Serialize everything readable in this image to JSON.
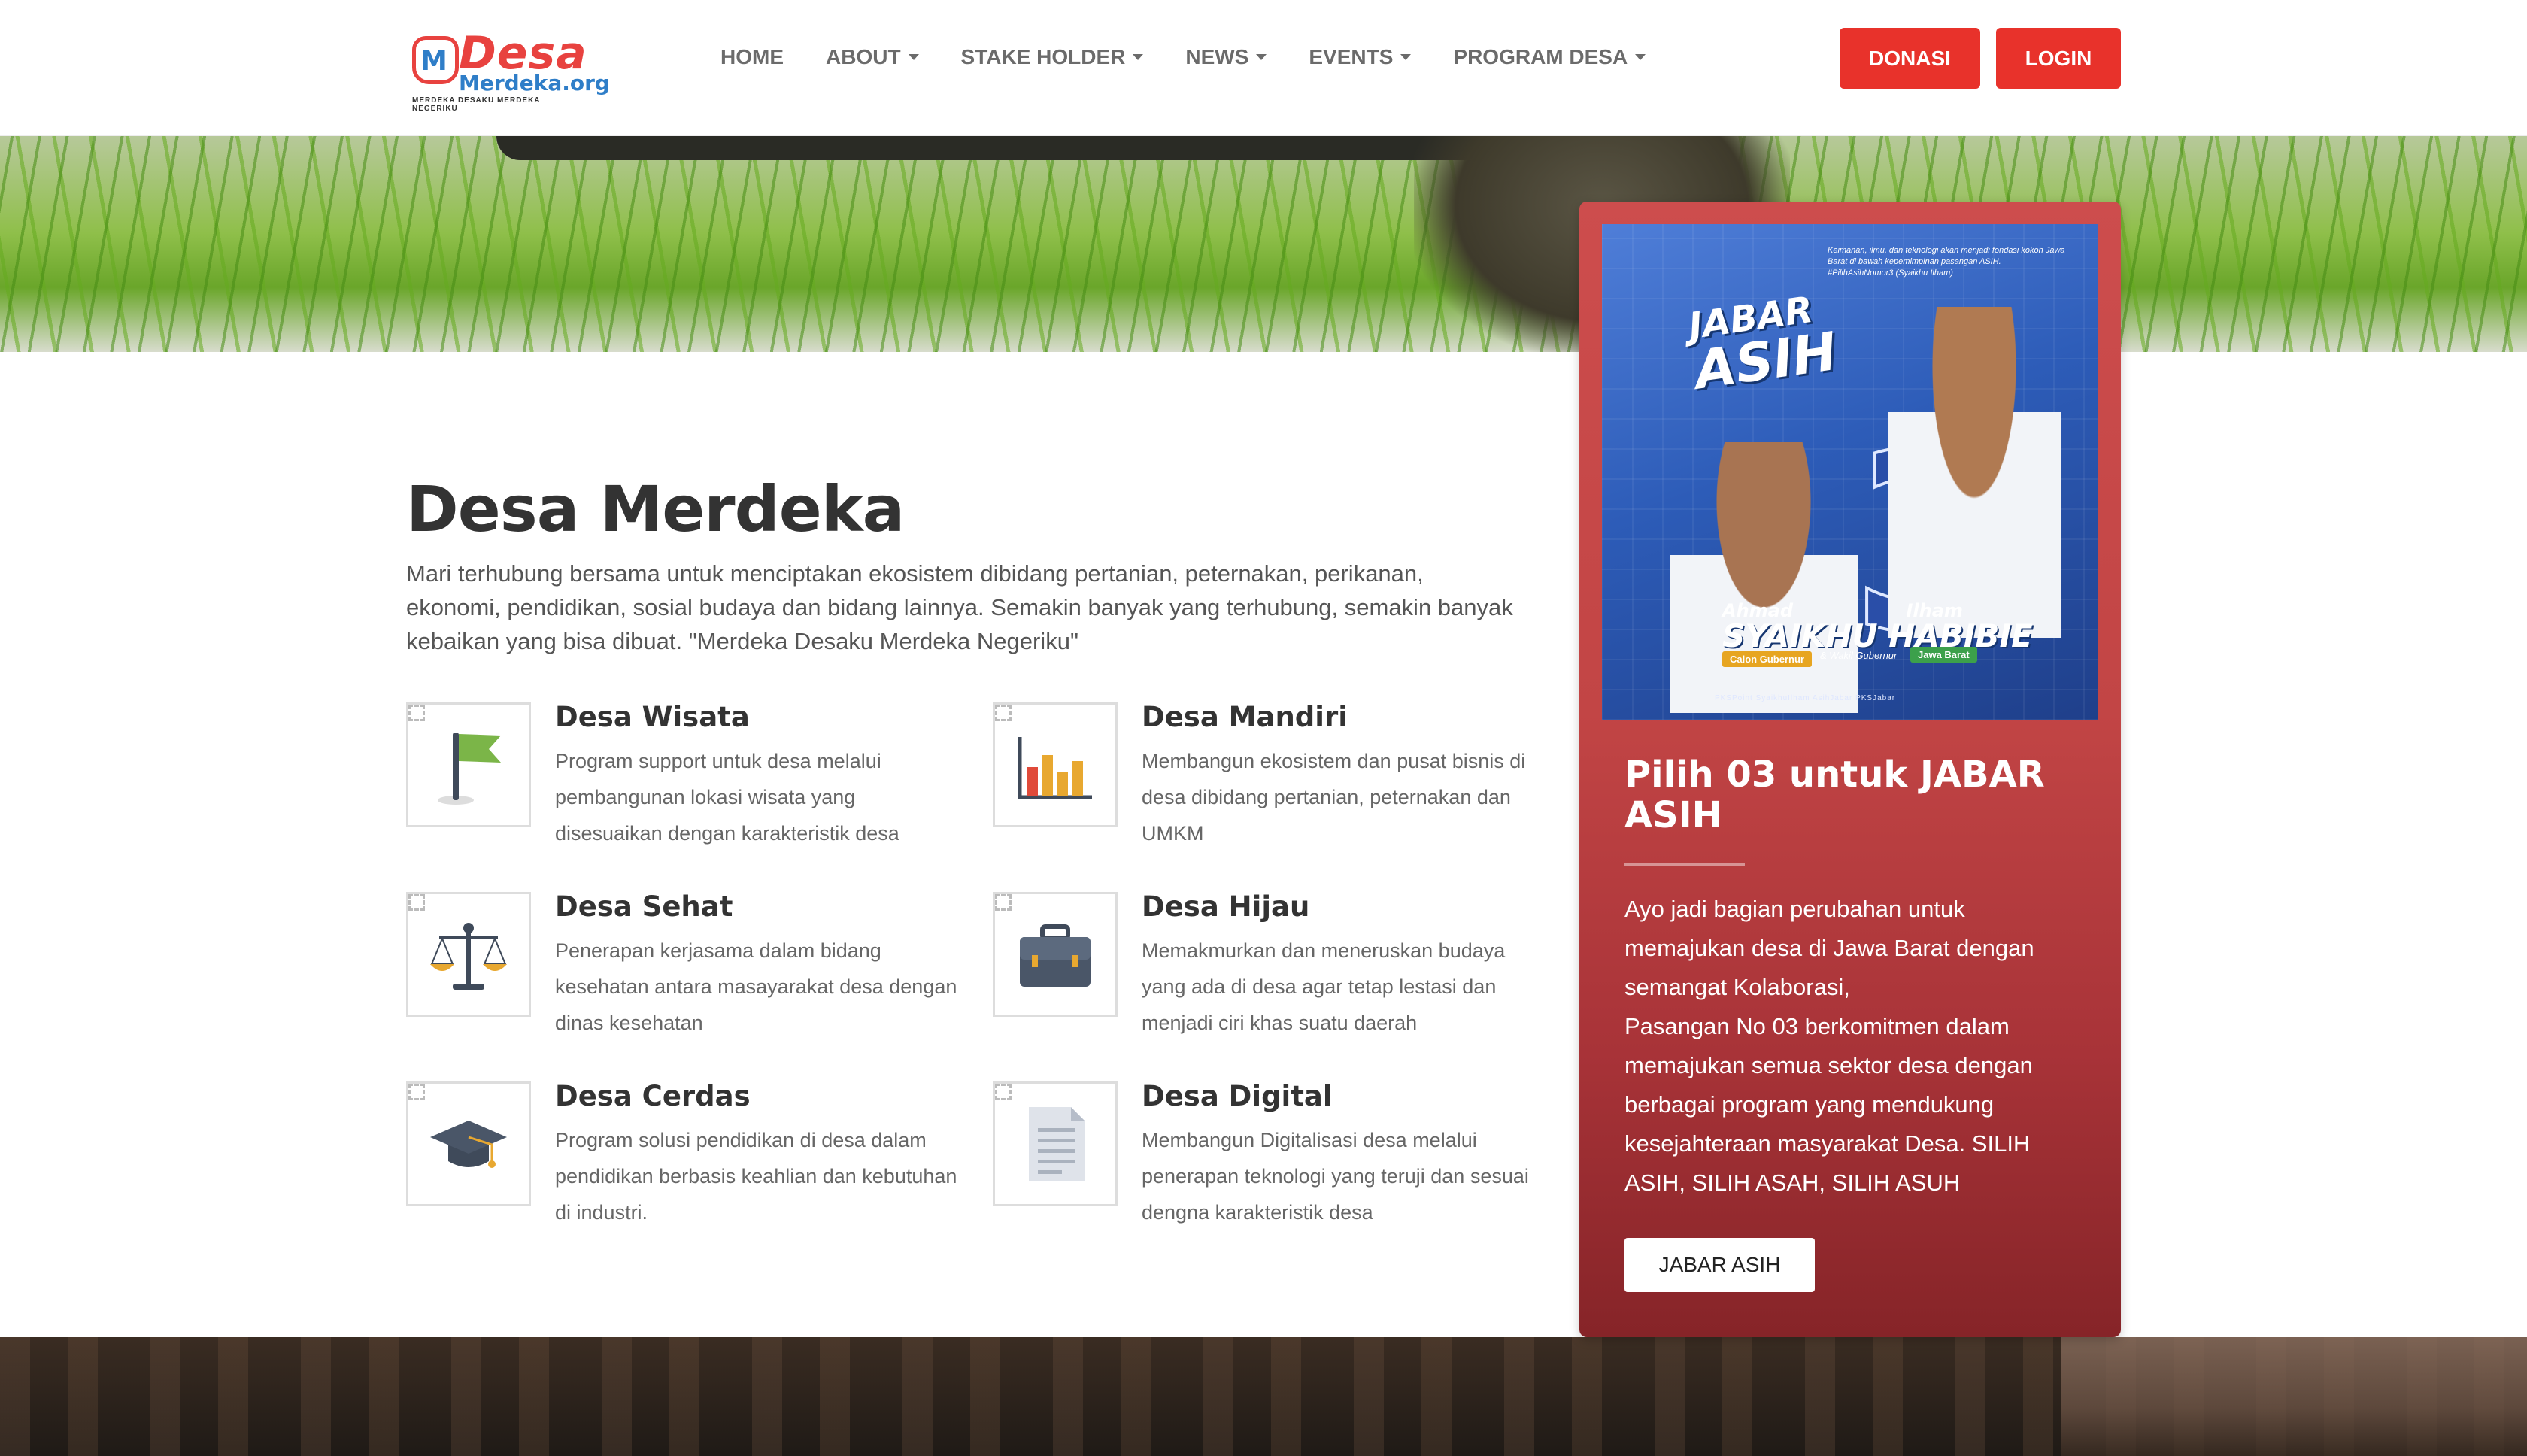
{
  "nav": {
    "logo": {
      "title": "Desa",
      "subtitle": "Merdeka.org",
      "badge": "M",
      "tagline": "MERDEKA DESAKU MERDEKA NEGERIKU"
    },
    "menu": [
      {
        "label": "HOME",
        "dropdown": false
      },
      {
        "label": "ABOUT",
        "dropdown": true
      },
      {
        "label": "STAKE HOLDER",
        "dropdown": true
      },
      {
        "label": "NEWS",
        "dropdown": true
      },
      {
        "label": "EVENTS",
        "dropdown": true
      },
      {
        "label": "PROGRAM DESA",
        "dropdown": true
      }
    ],
    "donate_label": "DONASI",
    "login_label": "LOGIN"
  },
  "main": {
    "title": "Desa Merdeka",
    "intro": "Mari terhubung bersama untuk menciptakan ekosistem dibidang pertanian, peternakan, perikanan, ekonomi, pendidikan, sosial budaya dan bidang lainnya. Semakin banyak yang terhubung, semakin banyak kebaikan yang bisa dibuat. \"Merdeka Desaku Merdeka Negeriku\"",
    "features": [
      {
        "title": "Desa Wisata",
        "text": "Program support untuk desa melalui pembangunan lokasi wisata yang disesuaikan dengan karakteristik desa",
        "icon": "flag-icon"
      },
      {
        "title": "Desa Mandiri",
        "text": "Membangun ekosistem dan pusat bisnis di desa dibidang pertanian, peternakan dan UMKM",
        "icon": "bar-chart-icon"
      },
      {
        "title": "Desa Sehat",
        "text": "Penerapan kerjasama dalam bidang kesehatan antara masayarakat desa dengan dinas kesehatan",
        "icon": "scales-icon"
      },
      {
        "title": "Desa Hijau",
        "text": "Memakmurkan dan meneruskan budaya yang ada di desa agar tetap lestasi dan menjadi ciri khas suatu daerah",
        "icon": "briefcase-icon"
      },
      {
        "title": "Desa Cerdas",
        "text": "Program solusi pendidikan di desa dalam pendidikan berbasis keahlian dan kebutuhan di industri.",
        "icon": "graduation-cap-icon"
      },
      {
        "title": "Desa Digital",
        "text": "Membangun Digitalisasi desa melalui penerapan teknologi yang teruji dan sesuai dengna karakteristik desa",
        "icon": "document-icon"
      }
    ]
  },
  "card": {
    "poster": {
      "headline_top": "JABAR",
      "headline_bottom": "ASIH",
      "number": "3",
      "tagline": "Keimanan, ilmu, dan teknologi akan menjadi fondasi kokoh Jawa Barat di bawah kepemimpinan pasangan ASIH. #PilihAsihNomor3 (Syaikhu Ilham)",
      "name1_first": "Ahmad",
      "name1_last": "SYAIKHU",
      "name2_first": "Ilham",
      "name2_last": "HABIBIE",
      "role1": "Calon Gubernur",
      "role_mid": "& Wakil Gubernur",
      "role2": "Jawa Barat",
      "footer": "PKSPoint  SyaikhuIlham  AsihJabar  PKSJabar"
    },
    "title": "Pilih 03 untuk JABAR ASIH",
    "description": "Ayo jadi bagian perubahan untuk memajukan desa di Jawa Barat dengan semangat Kolaborasi,\nPasangan No 03 berkomitmen dalam memajukan semua sektor desa dengan berbagai program yang mendukung kesejahteraan masyarakat Desa. SILIH ASIH, SILIH ASAH, SILIH ASUH",
    "cta_label": "JABAR ASIH"
  },
  "colors": {
    "accent": "#e8322b",
    "card": "#c24545",
    "text": "#333333"
  }
}
